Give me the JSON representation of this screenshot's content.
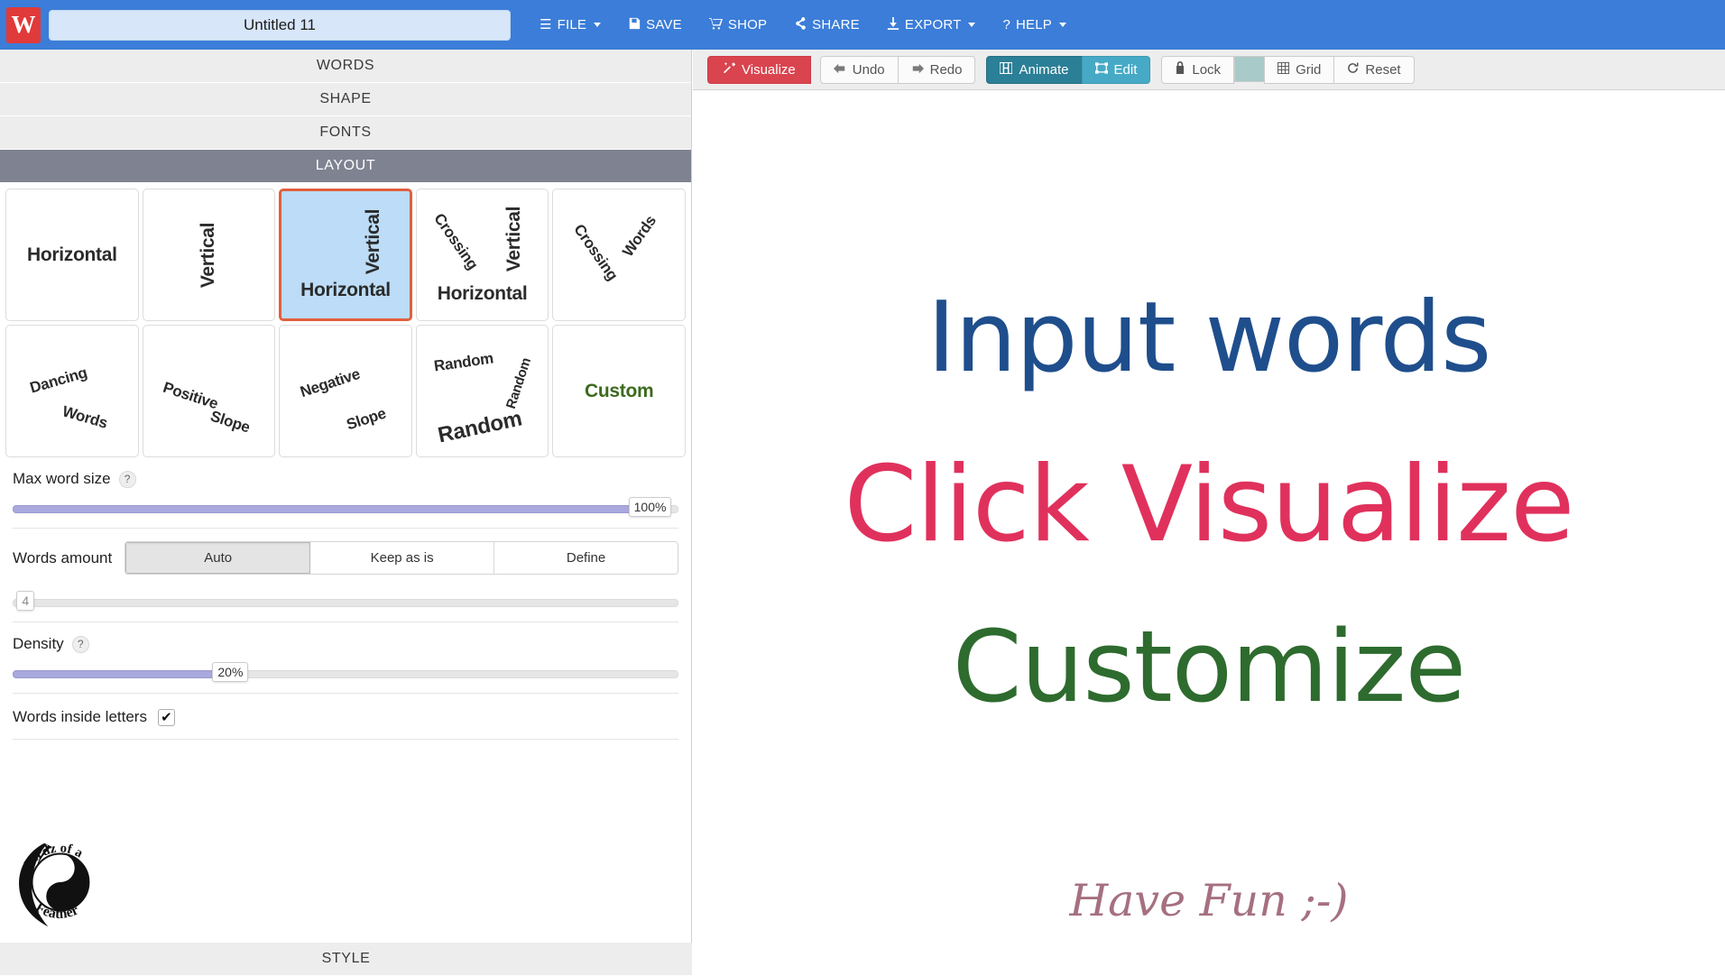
{
  "app": {
    "logo_letter": "W",
    "document_title": "Untitled 11",
    "title_placeholder": "Untitled"
  },
  "topbar": {
    "menu": [
      {
        "id": "file",
        "label": "FILE",
        "icon": "hamburger-icon",
        "glyph": "☰",
        "caret": true
      },
      {
        "id": "save",
        "label": "SAVE",
        "icon": "floppy-disk-icon",
        "glyph": "💾",
        "caret": false
      },
      {
        "id": "shop",
        "label": "SHOP",
        "icon": "shopping-cart-icon",
        "glyph": "🛒",
        "caret": false
      },
      {
        "id": "share",
        "label": "SHARE",
        "icon": "share-nodes-icon",
        "glyph": "≪",
        "caret": false
      },
      {
        "id": "export",
        "label": "EXPORT",
        "icon": "download-icon",
        "glyph": "⬇",
        "caret": true
      },
      {
        "id": "help",
        "label": "HELP",
        "icon": "question-mark-icon",
        "glyph": "?",
        "caret": true
      }
    ]
  },
  "sidebar": {
    "sections": [
      {
        "id": "words",
        "label": "WORDS",
        "active": false
      },
      {
        "id": "shape",
        "label": "SHAPE",
        "active": false
      },
      {
        "id": "fonts",
        "label": "FONTS",
        "active": false
      },
      {
        "id": "layout",
        "label": "LAYOUT",
        "active": true
      },
      {
        "id": "style",
        "label": "STYLE",
        "active": false
      }
    ],
    "layout_tiles": [
      {
        "id": "horizontal",
        "name": "horizontal",
        "words": [
          "Horizontal"
        ],
        "selected": false
      },
      {
        "id": "vertical",
        "name": "vertical",
        "words": [
          "Vertical"
        ],
        "selected": false
      },
      {
        "id": "vertical-horizontal",
        "name": "vertical-horizontal",
        "words": [
          "Vertical",
          "Horizontal"
        ],
        "selected": true
      },
      {
        "id": "crossing-vh",
        "name": "crossing-vertical-horizontal",
        "words": [
          "Crossing",
          "Vertical",
          "Horizontal"
        ],
        "selected": false
      },
      {
        "id": "crossing-words",
        "name": "crossing-words",
        "words": [
          "Crossing",
          "Words"
        ],
        "selected": false
      },
      {
        "id": "dancing-words",
        "name": "dancing-words",
        "words": [
          "Dancing",
          "Words"
        ],
        "selected": false
      },
      {
        "id": "positive-slope",
        "name": "positive-slope",
        "words": [
          "Positive",
          "Slope"
        ],
        "selected": false
      },
      {
        "id": "negative-slope",
        "name": "negative-slope",
        "words": [
          "Negative",
          "Slope"
        ],
        "selected": false
      },
      {
        "id": "random",
        "name": "random",
        "words": [
          "Random",
          "Random",
          "Random"
        ],
        "selected": false
      },
      {
        "id": "custom",
        "name": "custom",
        "words": [
          "Custom"
        ],
        "selected": false
      }
    ],
    "max_word_size": {
      "label": "Max word size",
      "help": "?",
      "value_label": "100%",
      "percent": 100
    },
    "words_amount": {
      "label": "Words amount",
      "options": [
        {
          "id": "auto",
          "label": "Auto",
          "active": true
        },
        {
          "id": "keep-as-is",
          "label": "Keep as is",
          "active": false
        },
        {
          "id": "define",
          "label": "Define",
          "active": false
        }
      ],
      "count_label": "4",
      "count_percent": 2
    },
    "density": {
      "label": "Density",
      "help": "?",
      "value_label": "20%",
      "percent": 20
    },
    "words_inside_letters": {
      "label": "Words inside letters",
      "checked": true,
      "check_glyph": "✔"
    },
    "watermark": {
      "name": "birdz-of-a-feather-logo",
      "text_top": "Birdz of a",
      "text_bottom": "Feather"
    }
  },
  "toolbar": {
    "buttons": [
      {
        "id": "visualize",
        "label": "Visualize",
        "icon": "magic-wand-icon",
        "glyph": "✨"
      },
      {
        "id": "undo",
        "label": "Undo",
        "icon": "arrow-left-icon",
        "glyph": "←"
      },
      {
        "id": "redo",
        "label": "Redo",
        "icon": "arrow-right-icon",
        "glyph": "→"
      },
      {
        "id": "animate",
        "label": "Animate",
        "icon": "film-icon",
        "glyph": "▤"
      },
      {
        "id": "edit",
        "label": "Edit",
        "icon": "crop-icon",
        "glyph": "⧉"
      },
      {
        "id": "lock",
        "label": "Lock",
        "icon": "padlock-icon",
        "glyph": "🔒"
      },
      {
        "id": "grid",
        "label": "Grid",
        "icon": "grid-icon",
        "glyph": "⊞"
      },
      {
        "id": "reset",
        "label": "Reset",
        "icon": "refresh-icon",
        "glyph": "↻"
      }
    ],
    "color_swatch": "#a8cac8"
  },
  "canvas": {
    "words": [
      {
        "id": "input-words",
        "text": "Input words",
        "color": "#1f4e8c"
      },
      {
        "id": "click-visualize",
        "text": "Click Visualize",
        "color": "#e0315c"
      },
      {
        "id": "customize",
        "text": "Customize",
        "color": "#2e6b2e"
      },
      {
        "id": "have-fun",
        "text": "Have Fun ;-)",
        "color": "#a5707f"
      }
    ]
  },
  "colors": {
    "brand_blue": "#3b7dd8",
    "logo_red": "#e03a3a",
    "visualize_red": "#d9444f",
    "animate_teal": "#2b7f96",
    "edit_teal": "#46aac6",
    "selected_tile_bg": "#bcdcf7",
    "selected_tile_border": "#e0603f",
    "active_section_bg": "#7f8290",
    "slider_fill": "#a9a9de"
  }
}
